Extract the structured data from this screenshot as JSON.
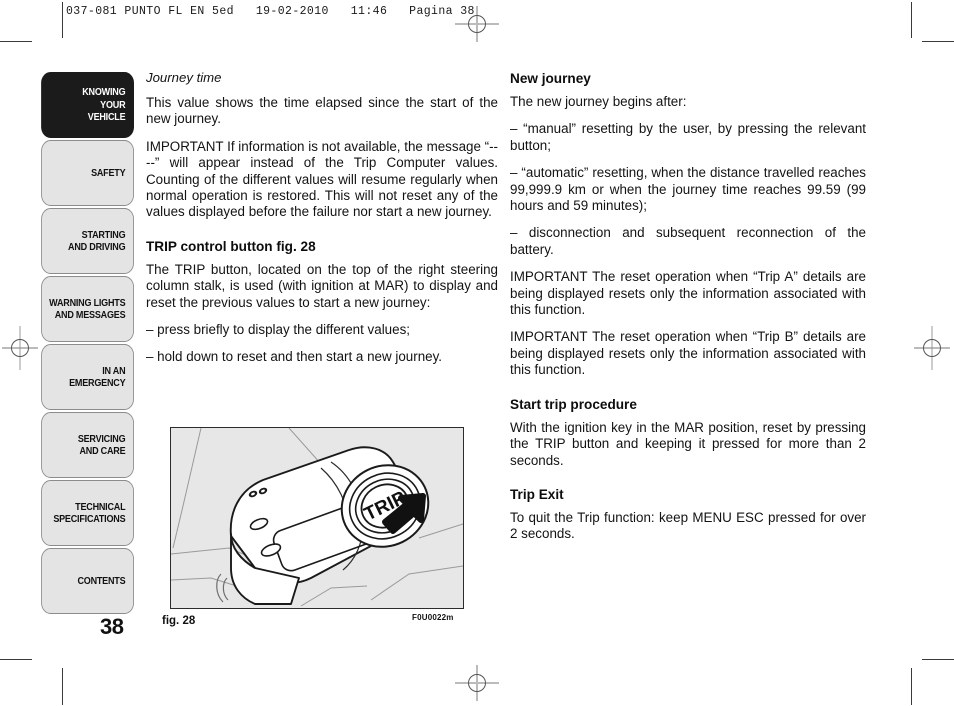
{
  "print_header": "037-081 PUNTO FL EN 5ed   19-02-2010   11:46   Pagina 38",
  "page_number": "38",
  "colors": {
    "active_tab_bg": "#1c1b1b",
    "tab_bg": "#e4e4e4",
    "tab_border": "#8c8c8c",
    "figure_bg": "#e7e7e7",
    "text": "#131313"
  },
  "sidebar": {
    "items": [
      {
        "lines": [
          "KNOWING",
          "YOUR",
          "VEHICLE"
        ],
        "active": true
      },
      {
        "lines": [
          "SAFETY"
        ],
        "active": false
      },
      {
        "lines": [
          "STARTING",
          "AND DRIVING"
        ],
        "active": false
      },
      {
        "lines": [
          "WARNING LIGHTS",
          "AND MESSAGES"
        ],
        "active": false
      },
      {
        "lines": [
          "IN AN",
          "EMERGENCY"
        ],
        "active": false
      },
      {
        "lines": [
          "SERVICING",
          "AND CARE"
        ],
        "active": false
      },
      {
        "lines": [
          "TECHNICAL",
          "SPECIFICATIONS"
        ],
        "active": false
      },
      {
        "lines": [
          "CONTENTS"
        ],
        "active": false
      }
    ]
  },
  "left_column": {
    "heading_journey_time": "Journey time",
    "para_journey_time": "This value shows the time elapsed since the start of the new journey.",
    "para_important_unavailable": "IMPORTANT If information is not available, the message “----” will appear instead of the Trip Computer values. Counting of the different values will resume regularly when normal operation is restored. This will not reset any of the values displayed before the failure nor start a new journey.",
    "heading_trip_control": "TRIP control button fig. 28",
    "para_trip_control": "The TRIP button, located on the top of the right steering column stalk, is used (with ignition at MAR) to display and reset the previous values to start a new journey:",
    "bullet_press_briefly": "– press briefly to display the different values;",
    "bullet_hold_down": "– hold down to reset and then start a new journey."
  },
  "right_column": {
    "heading_new_journey": "New journey",
    "para_begins_after": "The new journey begins after:",
    "bullet_manual": "– “manual” resetting by the user, by pressing the relevant button;",
    "bullet_automatic": "– “automatic” resetting, when the distance travelled reaches 99,999.9 km or when the journey time reaches 99.59 (99 hours and 59 minutes);",
    "bullet_disconnection": "– disconnection and subsequent reconnection of the battery.",
    "para_important_trip_a": "IMPORTANT The reset operation when “Trip A” details are being displayed resets only the information associated with this function.",
    "para_important_trip_b": "IMPORTANT The reset operation when “Trip B” details are being displayed resets only the information associated with this function.",
    "heading_start_trip": "Start trip procedure",
    "para_start_trip": "With the ignition key in the MAR position, reset by pressing the TRIP button and keeping it pressed for more than 2 seconds.",
    "heading_trip_exit": "Trip Exit",
    "para_trip_exit": "To quit the Trip function: keep MENU ESC pressed for over 2 seconds."
  },
  "figure": {
    "caption": "fig. 28",
    "code": "F0U0022m",
    "button_label": "TRIP",
    "alt": "Right steering column stalk with TRIP button at its end, black arrow pointing at the button"
  }
}
